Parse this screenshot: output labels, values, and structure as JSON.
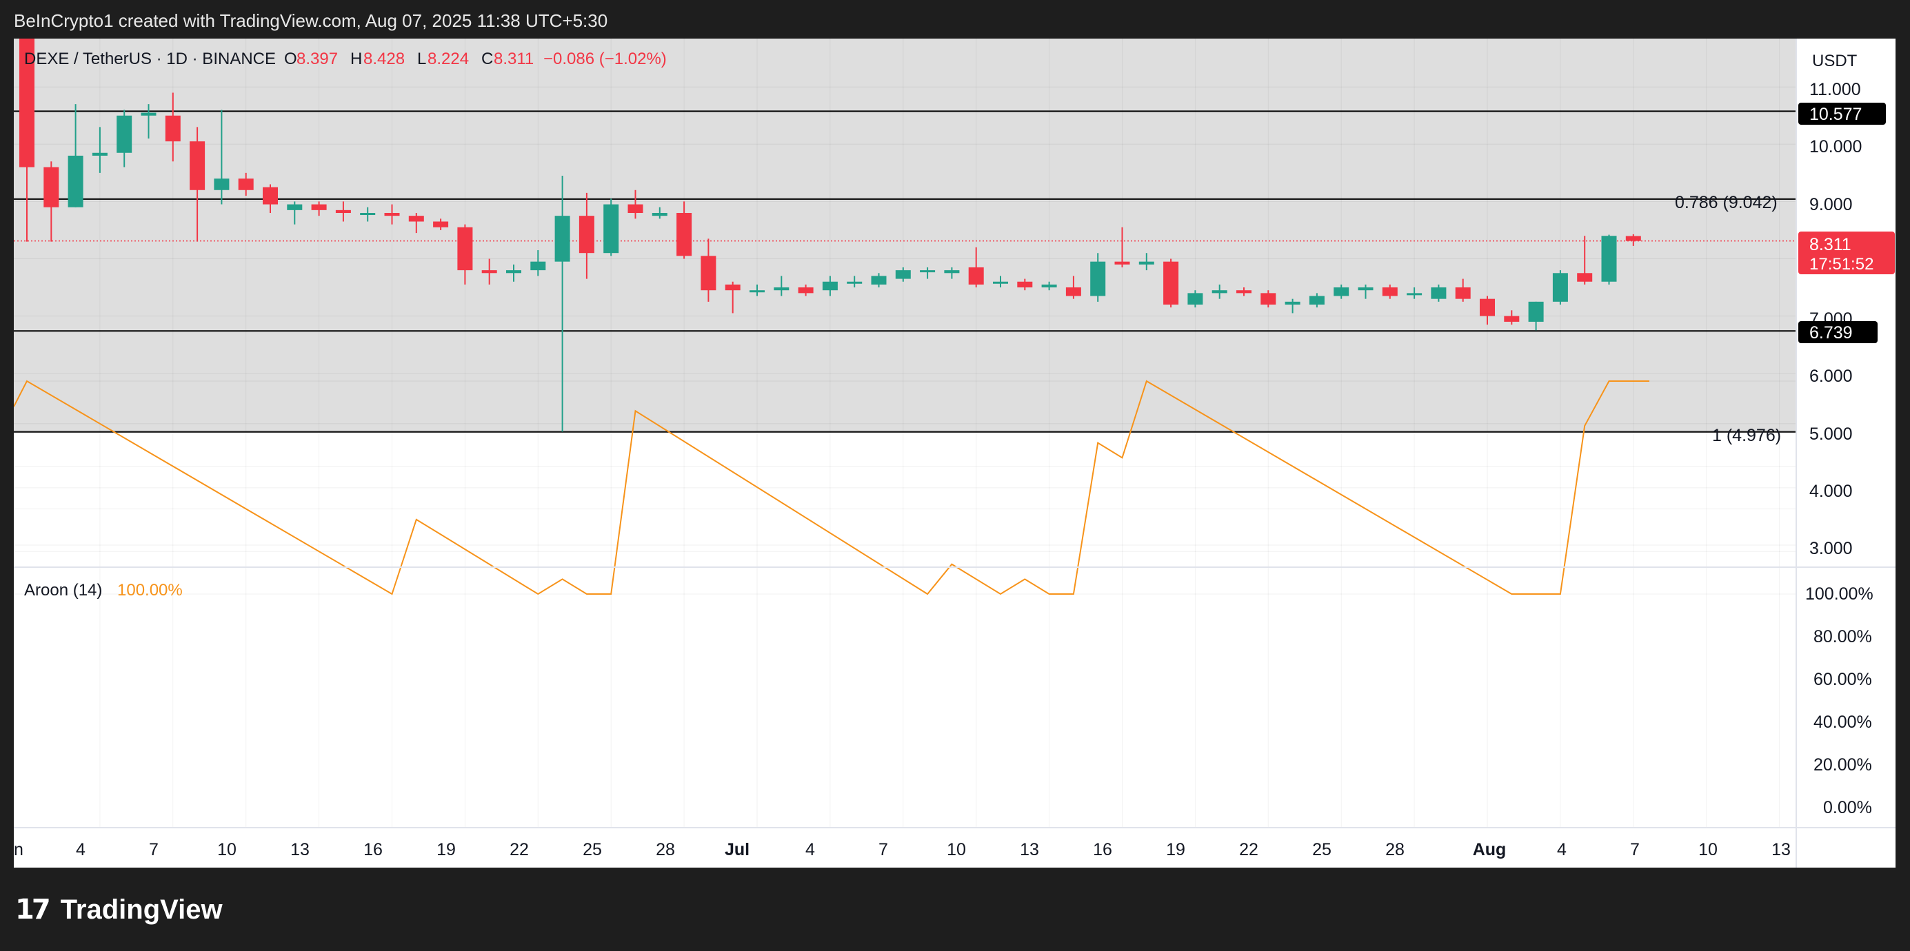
{
  "header": {
    "attribution": "BeInCrypto1 created with TradingView.com, Aug 07, 2025 11:38 UTC+5:30"
  },
  "legend": {
    "symbol": "DEXE / TetherUS · 1D · BINANCE",
    "o_label": "O",
    "o_value": "8.397",
    "h_label": "H",
    "h_value": "8.428",
    "l_label": "L",
    "l_value": "8.224",
    "c_label": "C",
    "c_value": "8.311",
    "change": "−0.086 (−1.02%)"
  },
  "price_axis": {
    "currency": "USDT",
    "ticks": [
      "11.000",
      "10.000",
      "9.000",
      "7.000",
      "6.000",
      "5.000",
      "4.000",
      "3.000"
    ],
    "last_price": "8.311",
    "countdown": "17:51:52"
  },
  "levels": {
    "upper_tag": "10.577",
    "lower_tag": "6.739",
    "fib_786": "0.786 (9.042)",
    "fib_1": "1 (4.976)"
  },
  "aroon": {
    "label": "Aroon (14)",
    "value": "100.00%",
    "ticks": [
      "100.00%",
      "80.00%",
      "60.00%",
      "40.00%",
      "20.00%",
      "0.00%"
    ]
  },
  "time_axis": {
    "labels": [
      "n",
      "4",
      "7",
      "10",
      "13",
      "16",
      "19",
      "22",
      "25",
      "28",
      "Jul",
      "4",
      "7",
      "10",
      "13",
      "16",
      "19",
      "22",
      "25",
      "28",
      "Aug",
      "4",
      "7",
      "10",
      "13"
    ]
  },
  "footer": {
    "brand": "TradingView"
  },
  "colors": {
    "up": "#22a08a",
    "down": "#f23645",
    "aroon_line": "#f7931a",
    "range_fill": "#dedede",
    "level_line": "#000000"
  },
  "chart_data": [
    {
      "type": "candlestick",
      "symbol": "DEXE / TetherUS",
      "timeframe": "1D",
      "ylim": [
        2.6,
        12.2
      ],
      "x_first_label": "Jun 1",
      "ohlc": [
        {
          "d": "Jun 1",
          "o": 12.4,
          "h": 12.7,
          "l": 8.3,
          "c": 9.6
        },
        {
          "d": "Jun 2",
          "o": 9.6,
          "h": 9.7,
          "l": 8.3,
          "c": 8.9
        },
        {
          "d": "Jun 3",
          "o": 8.9,
          "h": 10.7,
          "l": 8.9,
          "c": 9.8
        },
        {
          "d": "Jun 4",
          "o": 9.8,
          "h": 10.3,
          "l": 9.5,
          "c": 9.85
        },
        {
          "d": "Jun 5",
          "o": 9.85,
          "h": 10.6,
          "l": 9.6,
          "c": 10.5
        },
        {
          "d": "Jun 6",
          "o": 10.5,
          "h": 10.7,
          "l": 10.1,
          "c": 10.55
        },
        {
          "d": "Jun 7",
          "o": 10.5,
          "h": 10.9,
          "l": 9.7,
          "c": 10.05
        },
        {
          "d": "Jun 8",
          "o": 10.05,
          "h": 10.3,
          "l": 8.3,
          "c": 9.2
        },
        {
          "d": "Jun 9",
          "o": 9.2,
          "h": 10.6,
          "l": 8.95,
          "c": 9.4
        },
        {
          "d": "Jun 10",
          "o": 9.4,
          "h": 9.5,
          "l": 9.1,
          "c": 9.2
        },
        {
          "d": "Jun 11",
          "o": 9.25,
          "h": 9.3,
          "l": 8.8,
          "c": 8.95
        },
        {
          "d": "Jun 12",
          "o": 8.85,
          "h": 9.0,
          "l": 8.6,
          "c": 8.95
        },
        {
          "d": "Jun 13",
          "o": 8.95,
          "h": 9.0,
          "l": 8.75,
          "c": 8.85
        },
        {
          "d": "Jun 14",
          "o": 8.85,
          "h": 9.0,
          "l": 8.65,
          "c": 8.8
        },
        {
          "d": "Jun 15",
          "o": 8.8,
          "h": 8.9,
          "l": 8.65,
          "c": 8.8
        },
        {
          "d": "Jun 16",
          "o": 8.8,
          "h": 8.95,
          "l": 8.6,
          "c": 8.75
        },
        {
          "d": "Jun 17",
          "o": 8.75,
          "h": 8.8,
          "l": 8.45,
          "c": 8.65
        },
        {
          "d": "Jun 18",
          "o": 8.65,
          "h": 8.7,
          "l": 8.5,
          "c": 8.55
        },
        {
          "d": "Jun 19",
          "o": 8.55,
          "h": 8.6,
          "l": 7.55,
          "c": 7.8
        },
        {
          "d": "Jun 20",
          "o": 7.8,
          "h": 8.0,
          "l": 7.55,
          "c": 7.75
        },
        {
          "d": "Jun 21",
          "o": 7.75,
          "h": 7.9,
          "l": 7.6,
          "c": 7.8
        },
        {
          "d": "Jun 22",
          "o": 7.8,
          "h": 8.15,
          "l": 7.7,
          "c": 7.95
        },
        {
          "d": "Jun 23",
          "o": 7.95,
          "h": 9.45,
          "l": 4.98,
          "c": 8.75
        },
        {
          "d": "Jun 24",
          "o": 8.75,
          "h": 9.15,
          "l": 7.65,
          "c": 8.1
        },
        {
          "d": "Jun 25",
          "o": 8.1,
          "h": 9.05,
          "l": 8.05,
          "c": 8.95
        },
        {
          "d": "Jun 26",
          "o": 8.95,
          "h": 9.2,
          "l": 8.7,
          "c": 8.8
        },
        {
          "d": "Jun 27",
          "o": 8.75,
          "h": 8.9,
          "l": 8.7,
          "c": 8.8
        },
        {
          "d": "Jun 28",
          "o": 8.8,
          "h": 9.0,
          "l": 8.0,
          "c": 8.05
        },
        {
          "d": "Jun 29",
          "o": 8.05,
          "h": 8.35,
          "l": 7.25,
          "c": 7.45
        },
        {
          "d": "Jun 30",
          "o": 7.55,
          "h": 7.6,
          "l": 7.05,
          "c": 7.45
        },
        {
          "d": "Jul 1",
          "o": 7.45,
          "h": 7.55,
          "l": 7.35,
          "c": 7.45
        },
        {
          "d": "Jul 2",
          "o": 7.45,
          "h": 7.7,
          "l": 7.35,
          "c": 7.5
        },
        {
          "d": "Jul 3",
          "o": 7.5,
          "h": 7.55,
          "l": 7.35,
          "c": 7.4
        },
        {
          "d": "Jul 4",
          "o": 7.45,
          "h": 7.7,
          "l": 7.35,
          "c": 7.6
        },
        {
          "d": "Jul 5",
          "o": 7.6,
          "h": 7.7,
          "l": 7.5,
          "c": 7.6
        },
        {
          "d": "Jul 6",
          "o": 7.55,
          "h": 7.75,
          "l": 7.5,
          "c": 7.7
        },
        {
          "d": "Jul 7",
          "o": 7.65,
          "h": 7.85,
          "l": 7.6,
          "c": 7.8
        },
        {
          "d": "Jul 8",
          "o": 7.8,
          "h": 7.85,
          "l": 7.65,
          "c": 7.8
        },
        {
          "d": "Jul 9",
          "o": 7.75,
          "h": 7.85,
          "l": 7.65,
          "c": 7.8
        },
        {
          "d": "Jul 10",
          "o": 7.85,
          "h": 8.2,
          "l": 7.5,
          "c": 7.55
        },
        {
          "d": "Jul 11",
          "o": 7.6,
          "h": 7.7,
          "l": 7.5,
          "c": 7.6
        },
        {
          "d": "Jul 12",
          "o": 7.6,
          "h": 7.65,
          "l": 7.45,
          "c": 7.5
        },
        {
          "d": "Jul 13",
          "o": 7.5,
          "h": 7.6,
          "l": 7.45,
          "c": 7.55
        },
        {
          "d": "Jul 14",
          "o": 7.5,
          "h": 7.7,
          "l": 7.3,
          "c": 7.35
        },
        {
          "d": "Jul 15",
          "o": 7.35,
          "h": 8.1,
          "l": 7.25,
          "c": 7.95
        },
        {
          "d": "Jul 16",
          "o": 7.95,
          "h": 8.55,
          "l": 7.85,
          "c": 7.9
        },
        {
          "d": "Jul 17",
          "o": 7.9,
          "h": 8.1,
          "l": 7.8,
          "c": 7.95
        },
        {
          "d": "Jul 18",
          "o": 7.95,
          "h": 8.0,
          "l": 7.15,
          "c": 7.2
        },
        {
          "d": "Jul 19",
          "o": 7.2,
          "h": 7.45,
          "l": 7.15,
          "c": 7.4
        },
        {
          "d": "Jul 20",
          "o": 7.4,
          "h": 7.55,
          "l": 7.3,
          "c": 7.45
        },
        {
          "d": "Jul 21",
          "o": 7.45,
          "h": 7.5,
          "l": 7.35,
          "c": 7.4
        },
        {
          "d": "Jul 22",
          "o": 7.4,
          "h": 7.45,
          "l": 7.15,
          "c": 7.2
        },
        {
          "d": "Jul 23",
          "o": 7.2,
          "h": 7.3,
          "l": 7.05,
          "c": 7.25
        },
        {
          "d": "Jul 24",
          "o": 7.2,
          "h": 7.4,
          "l": 7.15,
          "c": 7.35
        },
        {
          "d": "Jul 25",
          "o": 7.35,
          "h": 7.55,
          "l": 7.3,
          "c": 7.5
        },
        {
          "d": "Jul 26",
          "o": 7.45,
          "h": 7.55,
          "l": 7.3,
          "c": 7.5
        },
        {
          "d": "Jul 27",
          "o": 7.5,
          "h": 7.55,
          "l": 7.3,
          "c": 7.35
        },
        {
          "d": "Jul 28",
          "o": 7.4,
          "h": 7.5,
          "l": 7.3,
          "c": 7.4
        },
        {
          "d": "Jul 29",
          "o": 7.3,
          "h": 7.55,
          "l": 7.25,
          "c": 7.5
        },
        {
          "d": "Jul 30",
          "o": 7.5,
          "h": 7.65,
          "l": 7.25,
          "c": 7.3
        },
        {
          "d": "Jul 31",
          "o": 7.3,
          "h": 7.35,
          "l": 6.85,
          "c": 7.0
        },
        {
          "d": "Aug 1",
          "o": 7.0,
          "h": 7.1,
          "l": 6.85,
          "c": 6.9
        },
        {
          "d": "Aug 2",
          "o": 6.9,
          "h": 7.25,
          "l": 6.75,
          "c": 7.25
        },
        {
          "d": "Aug 3",
          "o": 7.25,
          "h": 7.8,
          "l": 7.2,
          "c": 7.75
        },
        {
          "d": "Aug 4",
          "o": 7.75,
          "h": 8.4,
          "l": 7.55,
          "c": 7.6
        },
        {
          "d": "Aug 5",
          "o": 7.6,
          "h": 8.42,
          "l": 7.55,
          "c": 8.4
        },
        {
          "d": "Aug 6",
          "o": 8.397,
          "h": 8.428,
          "l": 8.224,
          "c": 8.311
        }
      ],
      "horizontal_levels": [
        {
          "value": 10.577,
          "label": "10.577"
        },
        {
          "value": 9.042,
          "label": "0.786 (9.042)"
        },
        {
          "value": 6.739,
          "label": "6.739"
        },
        {
          "value": 4.976,
          "label": "1 (4.976)"
        }
      ],
      "range_zone": [
        4.976,
        12.2
      ],
      "last_price": 8.311
    },
    {
      "type": "line",
      "title": "Aroon (14)",
      "ylim": [
        -6,
        106
      ],
      "unit": "%",
      "series": [
        {
          "name": "Aroon (14)",
          "points": [
            [
              "May 31",
              88
            ],
            [
              "Jun 1",
              100
            ],
            [
              "Jun 16",
              0
            ],
            [
              "Jun 17",
              35
            ],
            [
              "Jun 22",
              0
            ],
            [
              "Jun 23",
              7
            ],
            [
              "Jun 24",
              0
            ],
            [
              "Jun 25",
              0
            ],
            [
              "Jun 26",
              86
            ],
            [
              "Jul 8",
              0
            ],
            [
              "Jul 9",
              14
            ],
            [
              "Jul 11",
              0
            ],
            [
              "Jul 12",
              7
            ],
            [
              "Jul 13",
              0
            ],
            [
              "Jul 14",
              0
            ],
            [
              "Jul 15",
              71
            ],
            [
              "Jul 16",
              64
            ],
            [
              "Jul 17",
              100
            ],
            [
              "Aug 1",
              0
            ],
            [
              "Aug 3",
              0
            ],
            [
              "Aug 4",
              79
            ],
            [
              "Aug 5",
              100
            ],
            [
              "Aug 8",
              100
            ]
          ]
        }
      ]
    }
  ]
}
